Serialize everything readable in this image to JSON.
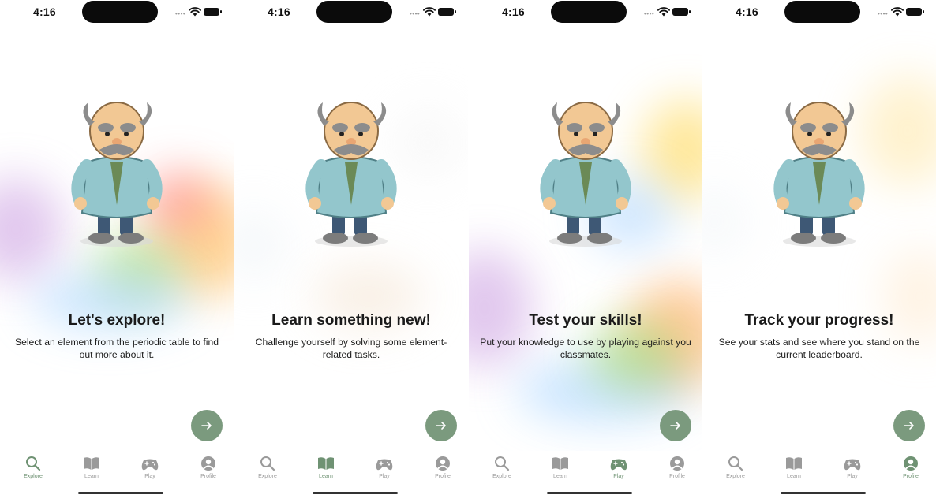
{
  "theme": {
    "accent": "#7b9a7e",
    "tab_active": "#6f9273",
    "tab_inactive": "#9a9a9a"
  },
  "tabs": [
    {
      "label": "Explore",
      "icon": "search-icon"
    },
    {
      "label": "Learn",
      "icon": "book-icon"
    },
    {
      "label": "Play",
      "icon": "gamepad-icon"
    },
    {
      "label": "Profile",
      "icon": "profile-icon"
    }
  ],
  "screens": [
    {
      "time": "4:16",
      "illustration": "scientist-with-flask-illustration",
      "title": "Let's explore!",
      "subtitle": "Select an element from the periodic table to find out more about it.",
      "active_tab": 0
    },
    {
      "time": "4:16",
      "illustration": "scientist-reading-book-illustration",
      "title": "Learn something new!",
      "subtitle": "Challenge yourself by solving some element-related tasks.",
      "active_tab": 1
    },
    {
      "time": "4:16",
      "illustration": "scientist-jumping-illustration",
      "title": "Test your skills!",
      "subtitle": "Put your knowledge to use by playing against you classmates.",
      "active_tab": 2
    },
    {
      "time": "4:16",
      "illustration": "scientist-with-books-illustration",
      "title": "Track your progress!",
      "subtitle": "See your stats and see where you stand on the current leaderboard.",
      "active_tab": 3
    }
  ]
}
